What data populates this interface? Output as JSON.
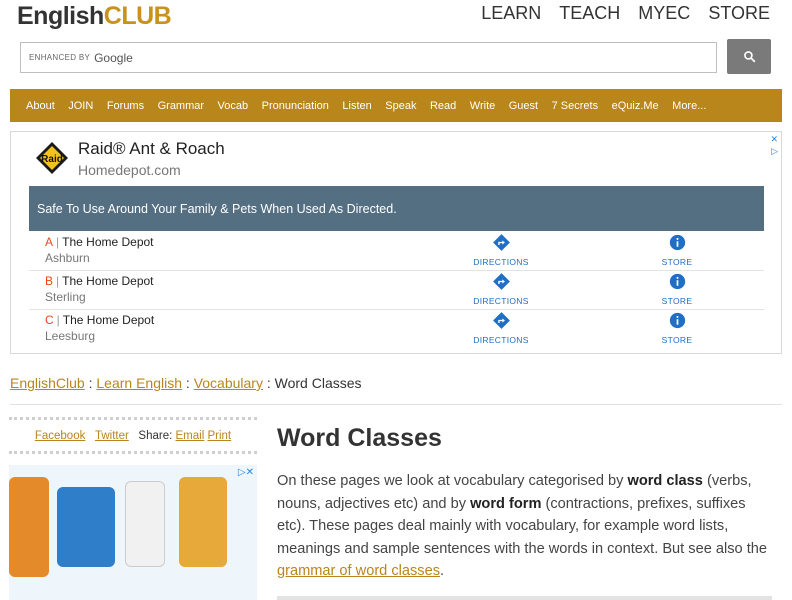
{
  "header": {
    "logo_part1": "English",
    "logo_part2": "CLUB",
    "nav": [
      "LEARN",
      "TEACH",
      "MYEC",
      "STORE"
    ]
  },
  "search": {
    "enhanced_label": "ENHANCED BY",
    "provider": "Google"
  },
  "navbar": {
    "items": [
      "About",
      "JOIN",
      "Forums",
      "Grammar",
      "Vocab",
      "Pronunciation",
      "Listen",
      "Speak",
      "Read",
      "Write",
      "Guest",
      "7 Secrets",
      "eQuiz.Me",
      "More..."
    ]
  },
  "ad": {
    "title": "Raid® Ant & Roach",
    "domain": "Homedepot.com",
    "banner": "Safe To Use Around Your Family & Pets When Used As Directed.",
    "rows": [
      {
        "letter": "A",
        "store": "The Home Depot",
        "city": "Ashburn",
        "directions": "DIRECTIONS",
        "store_label": "STORE"
      },
      {
        "letter": "B",
        "store": "The Home Depot",
        "city": "Sterling",
        "directions": "DIRECTIONS",
        "store_label": "STORE"
      },
      {
        "letter": "C",
        "store": "The Home Depot",
        "city": "Leesburg",
        "directions": "DIRECTIONS",
        "store_label": "STORE"
      }
    ],
    "accent_color": "#1e6fc5",
    "banner_color": "#546e82"
  },
  "breadcrumb": {
    "items": [
      "EnglishClub",
      "Learn English",
      "Vocabulary"
    ],
    "current": "Word Classes",
    "separator": " : "
  },
  "share": {
    "facebook": "Facebook",
    "twitter": "Twitter",
    "share_label": "Share:",
    "email": "Email",
    "print": "Print"
  },
  "main": {
    "title": "Word Classes",
    "p1_a": "On these pages we look at vocabulary categorised by ",
    "p1_b": "word class",
    "p1_c": " (verbs, nouns, adjectives etc) and by ",
    "p1_d": "word form",
    "p1_e": " (contractions, prefixes, suffixes etc). These pages deal mainly with vocabulary, for example word lists, meanings and sample sentences with the words in context. But see also the ",
    "p1_link": "grammar of word classes",
    "p1_end": "."
  },
  "theme": {
    "brand": "#b8861a",
    "text": "#333333"
  }
}
